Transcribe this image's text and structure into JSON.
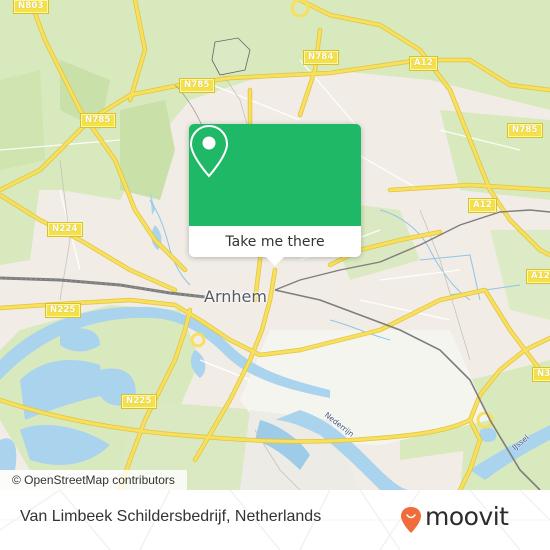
{
  "map": {
    "colors": {
      "land": "#f1ede6",
      "green": "#d6e8b9",
      "green_dark": "#c4dea3",
      "water": "#a9d3ee",
      "road_major": "#f6dc5e",
      "road_casing": "#e2c43a",
      "rail": "#7a7a7a",
      "popup_green": "#1fb866"
    },
    "place_labels": [
      {
        "name": "city-label-arnhem",
        "text": "Arnhem"
      }
    ],
    "river_labels": [
      {
        "name": "river-label-nederrijn",
        "text": "Nederrijn"
      },
      {
        "name": "river-label-ijssel",
        "text": "IJssel"
      }
    ],
    "road_shields": [
      {
        "name": "road-shield-n803",
        "text": "N803"
      },
      {
        "name": "road-shield-n785-west",
        "text": "N785"
      },
      {
        "name": "road-shield-n785-center",
        "text": "N785"
      },
      {
        "name": "road-shield-n784",
        "text": "N784"
      },
      {
        "name": "road-shield-a12-north",
        "text": "A12"
      },
      {
        "name": "road-shield-n785-east",
        "text": "N785"
      },
      {
        "name": "road-shield-a12-east",
        "text": "A12"
      },
      {
        "name": "road-shield-a12-edge",
        "text": "A12"
      },
      {
        "name": "road-shield-n224",
        "text": "N224"
      },
      {
        "name": "road-shield-n225-west",
        "text": "N225"
      },
      {
        "name": "road-shield-n225-south",
        "text": "N225"
      },
      {
        "name": "road-shield-n3",
        "text": "N3"
      }
    ],
    "attribution": "© OpenStreetMap contributors"
  },
  "popup": {
    "icon": "location-pin-icon",
    "button_label": "Take me there"
  },
  "footer": {
    "title": "Van Limbeek Schildersbedrijf, Netherlands",
    "brand": "moovit",
    "brand_color": "#f26b3a"
  }
}
